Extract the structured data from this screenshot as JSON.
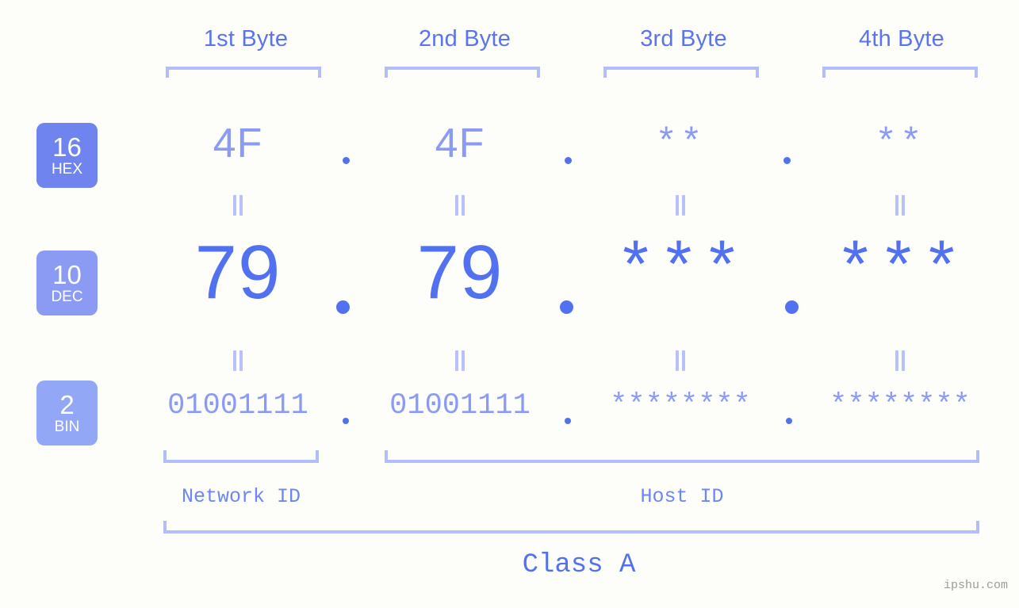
{
  "meta": {
    "background_color": "#fdfefa",
    "accent_strong": "#5271f0",
    "accent_light": "#8b9bf3",
    "bracket_color": "#b3bdf7",
    "watermark": "ipshu.com"
  },
  "byte_headers": [
    {
      "label": "1st Byte"
    },
    {
      "label": "2nd Byte"
    },
    {
      "label": "3rd Byte"
    },
    {
      "label": "4th Byte"
    }
  ],
  "bases": [
    {
      "number": "16",
      "abbr": "HEX",
      "color": "#6f84ef"
    },
    {
      "number": "10",
      "abbr": "DEC",
      "color": "#8b9bf3"
    },
    {
      "number": "2",
      "abbr": "BIN",
      "color": "#93a7f7"
    }
  ],
  "rows": {
    "hex": {
      "values": [
        "4F",
        "4F",
        "**",
        "**"
      ]
    },
    "dec": {
      "values": [
        "79",
        "79",
        "***",
        "***"
      ]
    },
    "bin": {
      "values": [
        "01001111",
        "01001111",
        "********",
        "********"
      ]
    }
  },
  "separator": ".",
  "equality_mark": "||",
  "segments": {
    "network_id": "Network ID",
    "host_id": "Host ID",
    "class": "Class A"
  }
}
